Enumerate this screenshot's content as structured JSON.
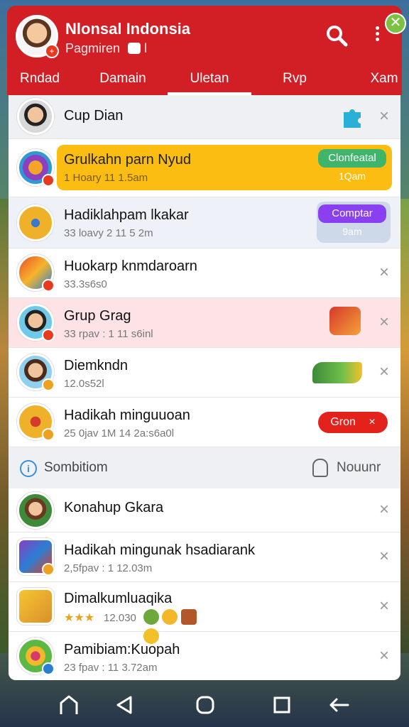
{
  "header": {
    "title": "Nlonsal Indonsia",
    "subtitle": "Pagmiren",
    "subtitle_suffix": "l",
    "close_symbol": "✕"
  },
  "tabs": [
    {
      "label": "Rndad"
    },
    {
      "label": "Damain"
    },
    {
      "label": "Uletan"
    },
    {
      "label": "Rvp"
    },
    {
      "label": "Xam"
    }
  ],
  "rows": [
    {
      "name": "Cup Dian",
      "meta": ""
    },
    {
      "name": "Grulkahn parn Nyud",
      "meta": "1 Hoary 11 1.5am",
      "button": "Clonfeatal",
      "button_sub": "1Qam"
    },
    {
      "name": "Hadiklahpam lkakar",
      "meta": "33 loavy 2 11 5 2m",
      "button": "Comptar",
      "button_sub": "9am"
    },
    {
      "name": "Huokarp knmdaroarn",
      "meta": "33.3s6s0"
    },
    {
      "name": "Grup Grag",
      "meta": "33 rpav : 1 11 s6inl"
    },
    {
      "name": "Diemkndn",
      "meta": "12.0s52l"
    },
    {
      "name": "Hadikah minguuoan",
      "meta": "25 0jav 1M 14 2a:s6a0l",
      "button": "Gron"
    }
  ],
  "section": {
    "label": "Sombitiom",
    "right_label": "Nouunr",
    "info_symbol": "i"
  },
  "rows2": [
    {
      "name": "Konahup Gkara",
      "meta": ""
    },
    {
      "name": "Hadikah mingunak hsadiarank",
      "meta": "2,5fpav : 1 12.03m"
    },
    {
      "name": "Dimalkumluaqika",
      "meta": "12.030"
    },
    {
      "name": "Pamibiam:Kuopah",
      "meta": "23 fpav : 11 3.72am"
    }
  ],
  "close_symbol": "×",
  "colors": {
    "header": "#d21f26",
    "yellow": "#fbbd12",
    "green": "#3fb56b",
    "purple": "#8a3ff0",
    "red": "#e3221c",
    "pink": "#fde3e6"
  },
  "icons": [
    "search-icon",
    "more-icon",
    "home-icon",
    "back-icon",
    "circle-icon",
    "square-icon",
    "return-icon"
  ]
}
